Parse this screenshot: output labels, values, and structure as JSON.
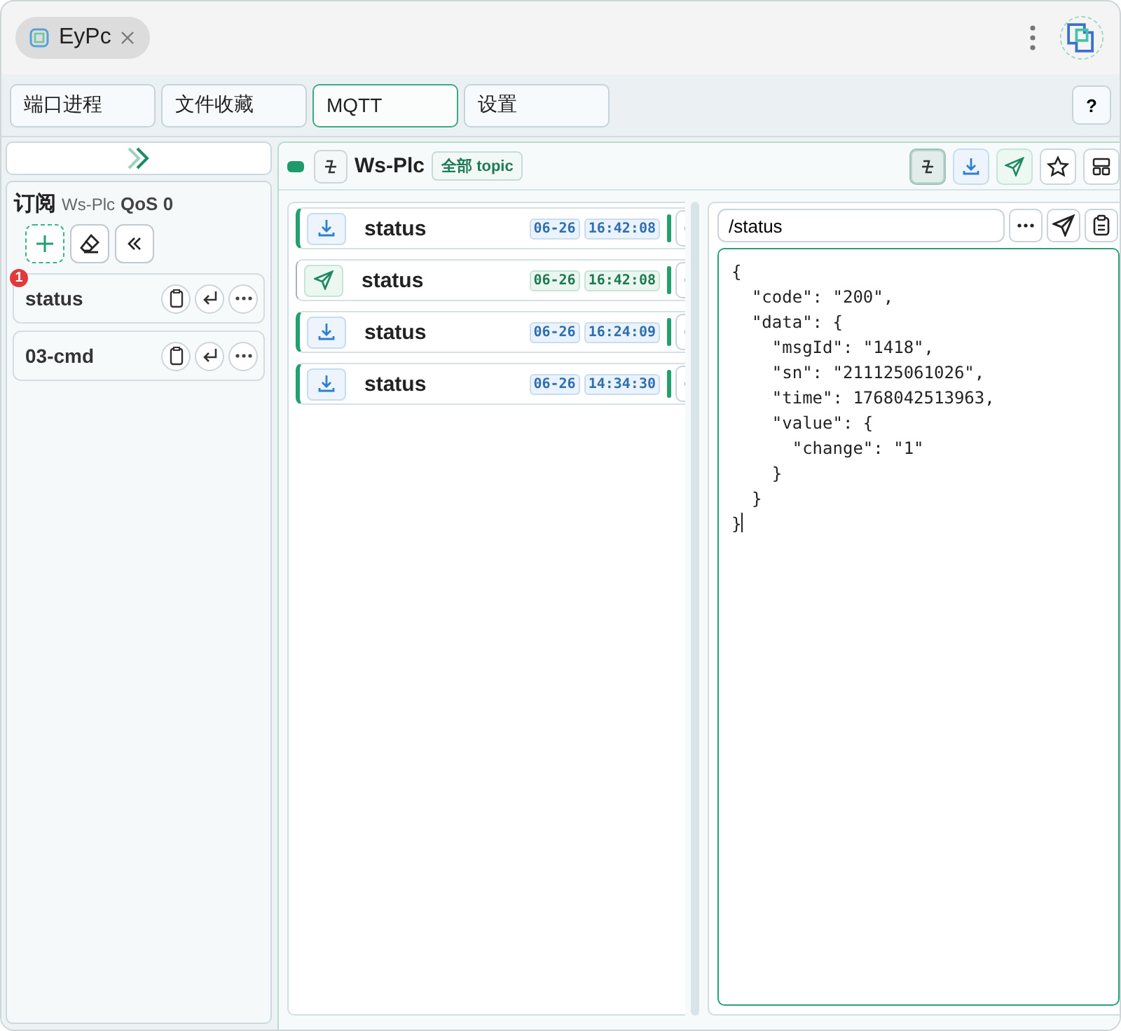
{
  "window_tab": {
    "title": "EyPc",
    "closable": true
  },
  "nav_tabs": [
    {
      "label": "端口进程",
      "selected": false
    },
    {
      "label": "文件收藏",
      "selected": false
    },
    {
      "label": "MQTT",
      "selected": true
    },
    {
      "label": "设置",
      "selected": false
    }
  ],
  "help_button": "?",
  "sidebar": {
    "title": "订阅",
    "connection": "Ws-Plc",
    "qos": "QoS 0",
    "subscriptions": [
      {
        "topic": "status",
        "badge": "1"
      },
      {
        "topic": "03-cmd"
      }
    ]
  },
  "header": {
    "connected": true,
    "name": "Ws-Plc",
    "filter": "全部 topic",
    "toolbar": [
      {
        "kind": "mode",
        "active": true
      },
      {
        "kind": "received",
        "active": false
      },
      {
        "kind": "sent",
        "active": false
      },
      {
        "kind": "star",
        "active": false
      },
      {
        "kind": "layout",
        "active": false
      }
    ]
  },
  "messages": [
    {
      "kind": "received",
      "topic": "status",
      "date": "06-26",
      "time": "16:42:08"
    },
    {
      "kind": "sent",
      "topic": "status",
      "date": "06-26",
      "time": "16:42:08"
    },
    {
      "kind": "received",
      "topic": "status",
      "date": "06-26",
      "time": "16:24:09"
    },
    {
      "kind": "received",
      "topic": "status",
      "date": "06-26",
      "time": "14:34:30"
    }
  ],
  "editor": {
    "topic": "/status",
    "payload": "{\n  \"code\": \"200\",\n  \"data\": {\n    \"msgId\": \"1418\",\n    \"sn\": \"211125061026\",\n    \"time\": 1768042513963,\n    \"value\": {\n      \"change\": \"1\"\n    }\n  }\n}"
  }
}
